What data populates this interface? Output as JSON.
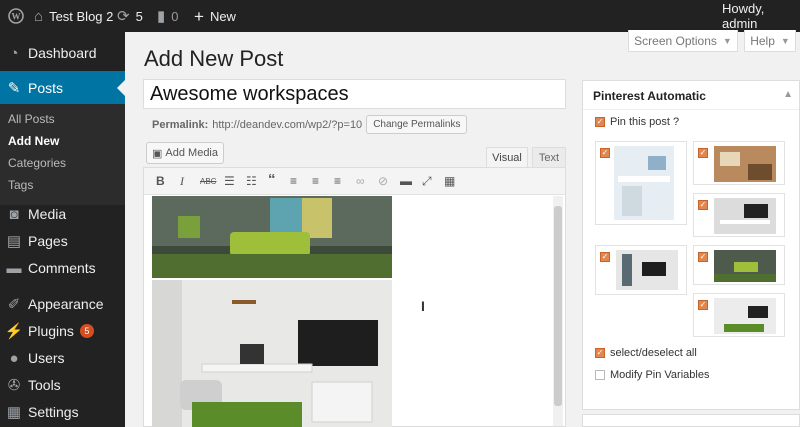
{
  "adminbar": {
    "site_name": "Test Blog 2",
    "updates_count": "5",
    "comments_count": "0",
    "new_label": "New",
    "howdy": "Howdy, admin"
  },
  "sidebar": {
    "dashboard": "Dashboard",
    "posts": "Posts",
    "sub": [
      "All Posts",
      "Add New",
      "Categories",
      "Tags"
    ],
    "media": "Media",
    "pages": "Pages",
    "comments": "Comments",
    "appearance": "Appearance",
    "plugins": "Plugins",
    "plugins_badge": "5",
    "users": "Users",
    "tools": "Tools",
    "settings": "Settings"
  },
  "header": {
    "screen_options": "Screen Options",
    "help": "Help",
    "page_title": "Add New Post"
  },
  "post": {
    "title_value": "Awesome workspaces",
    "permalink_label": "Permalink:",
    "permalink_url": "http://deandev.com/wp2/?p=10",
    "change_permalinks": "Change Permalinks",
    "add_media": "Add Media",
    "tab_visual": "Visual",
    "tab_text": "Text"
  },
  "toolbar": {
    "bold": "B",
    "italic": "I",
    "strike": "ABC",
    "quote": "“"
  },
  "pinterest": {
    "title": "Pinterest Automatic",
    "pin_this": "Pin this post ?",
    "select_all": "select/deselect all",
    "modify_vars": "Modify Pin Variables"
  },
  "colors": {
    "adminbar_bg": "#222222",
    "accent": "#0074a2",
    "badge": "#d54e21",
    "checkbox_on": "#e0864e"
  }
}
